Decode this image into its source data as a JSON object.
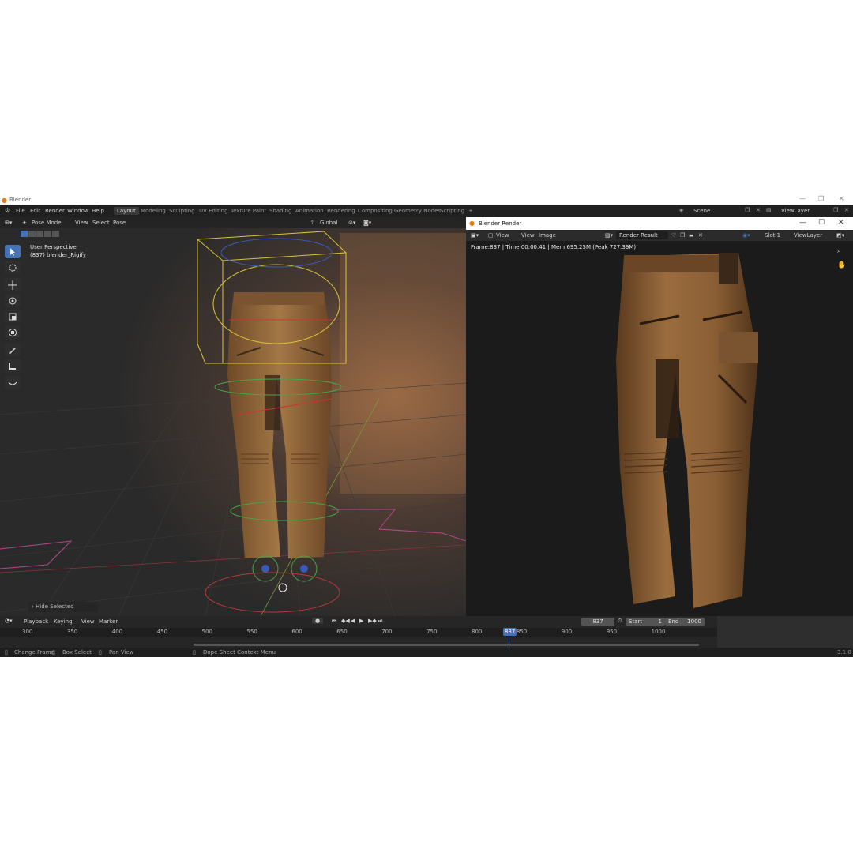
{
  "app": {
    "title": "Blender",
    "version": "3.1.0"
  },
  "menu": {
    "items": [
      "File",
      "Edit",
      "Render",
      "Window",
      "Help"
    ]
  },
  "workspaces": {
    "tabs": [
      "Layout",
      "Modeling",
      "Sculpting",
      "UV Editing",
      "Texture Paint",
      "Shading",
      "Animation",
      "Rendering",
      "Compositing",
      "Geometry Nodes",
      "Scripting"
    ],
    "active": "Layout",
    "add": "+"
  },
  "scene": {
    "label": "Scene",
    "view_layer": "ViewLayer"
  },
  "viewport": {
    "mode": "Pose Mode",
    "menus": [
      "View",
      "Select",
      "Pose"
    ],
    "orientation": "Global",
    "overlay_line1": "User Perspective",
    "overlay_line2": "(837) blender_Rigify",
    "last_op": "Hide Selected"
  },
  "render_window": {
    "title": "Blender Render",
    "menus": [
      "View",
      "View",
      "Image"
    ],
    "image_name": "Render Result",
    "slot": "Slot 1",
    "view_layer": "ViewLayer",
    "stats": "Frame:837 | Time:00:00.41 | Mem:695.25M (Peak 727.39M)"
  },
  "timeline": {
    "menus": [
      "Playback",
      "Keying",
      "View",
      "Marker"
    ],
    "current_frame": "837",
    "start_label": "Start",
    "start": "1",
    "end_label": "End",
    "end": "1000",
    "ticks": [
      "300",
      "350",
      "400",
      "450",
      "500",
      "550",
      "600",
      "650",
      "700",
      "750",
      "800",
      "850",
      "900",
      "950",
      "1000"
    ],
    "frame_marker": "837"
  },
  "statusbar": {
    "items": [
      "Change Frame",
      "Box Select",
      "Pan View",
      "Dope Sheet Context Menu"
    ]
  },
  "colors": {
    "accent": "#4772b3",
    "bg_dark": "#1b1b1b",
    "pants": "#8a6236"
  }
}
